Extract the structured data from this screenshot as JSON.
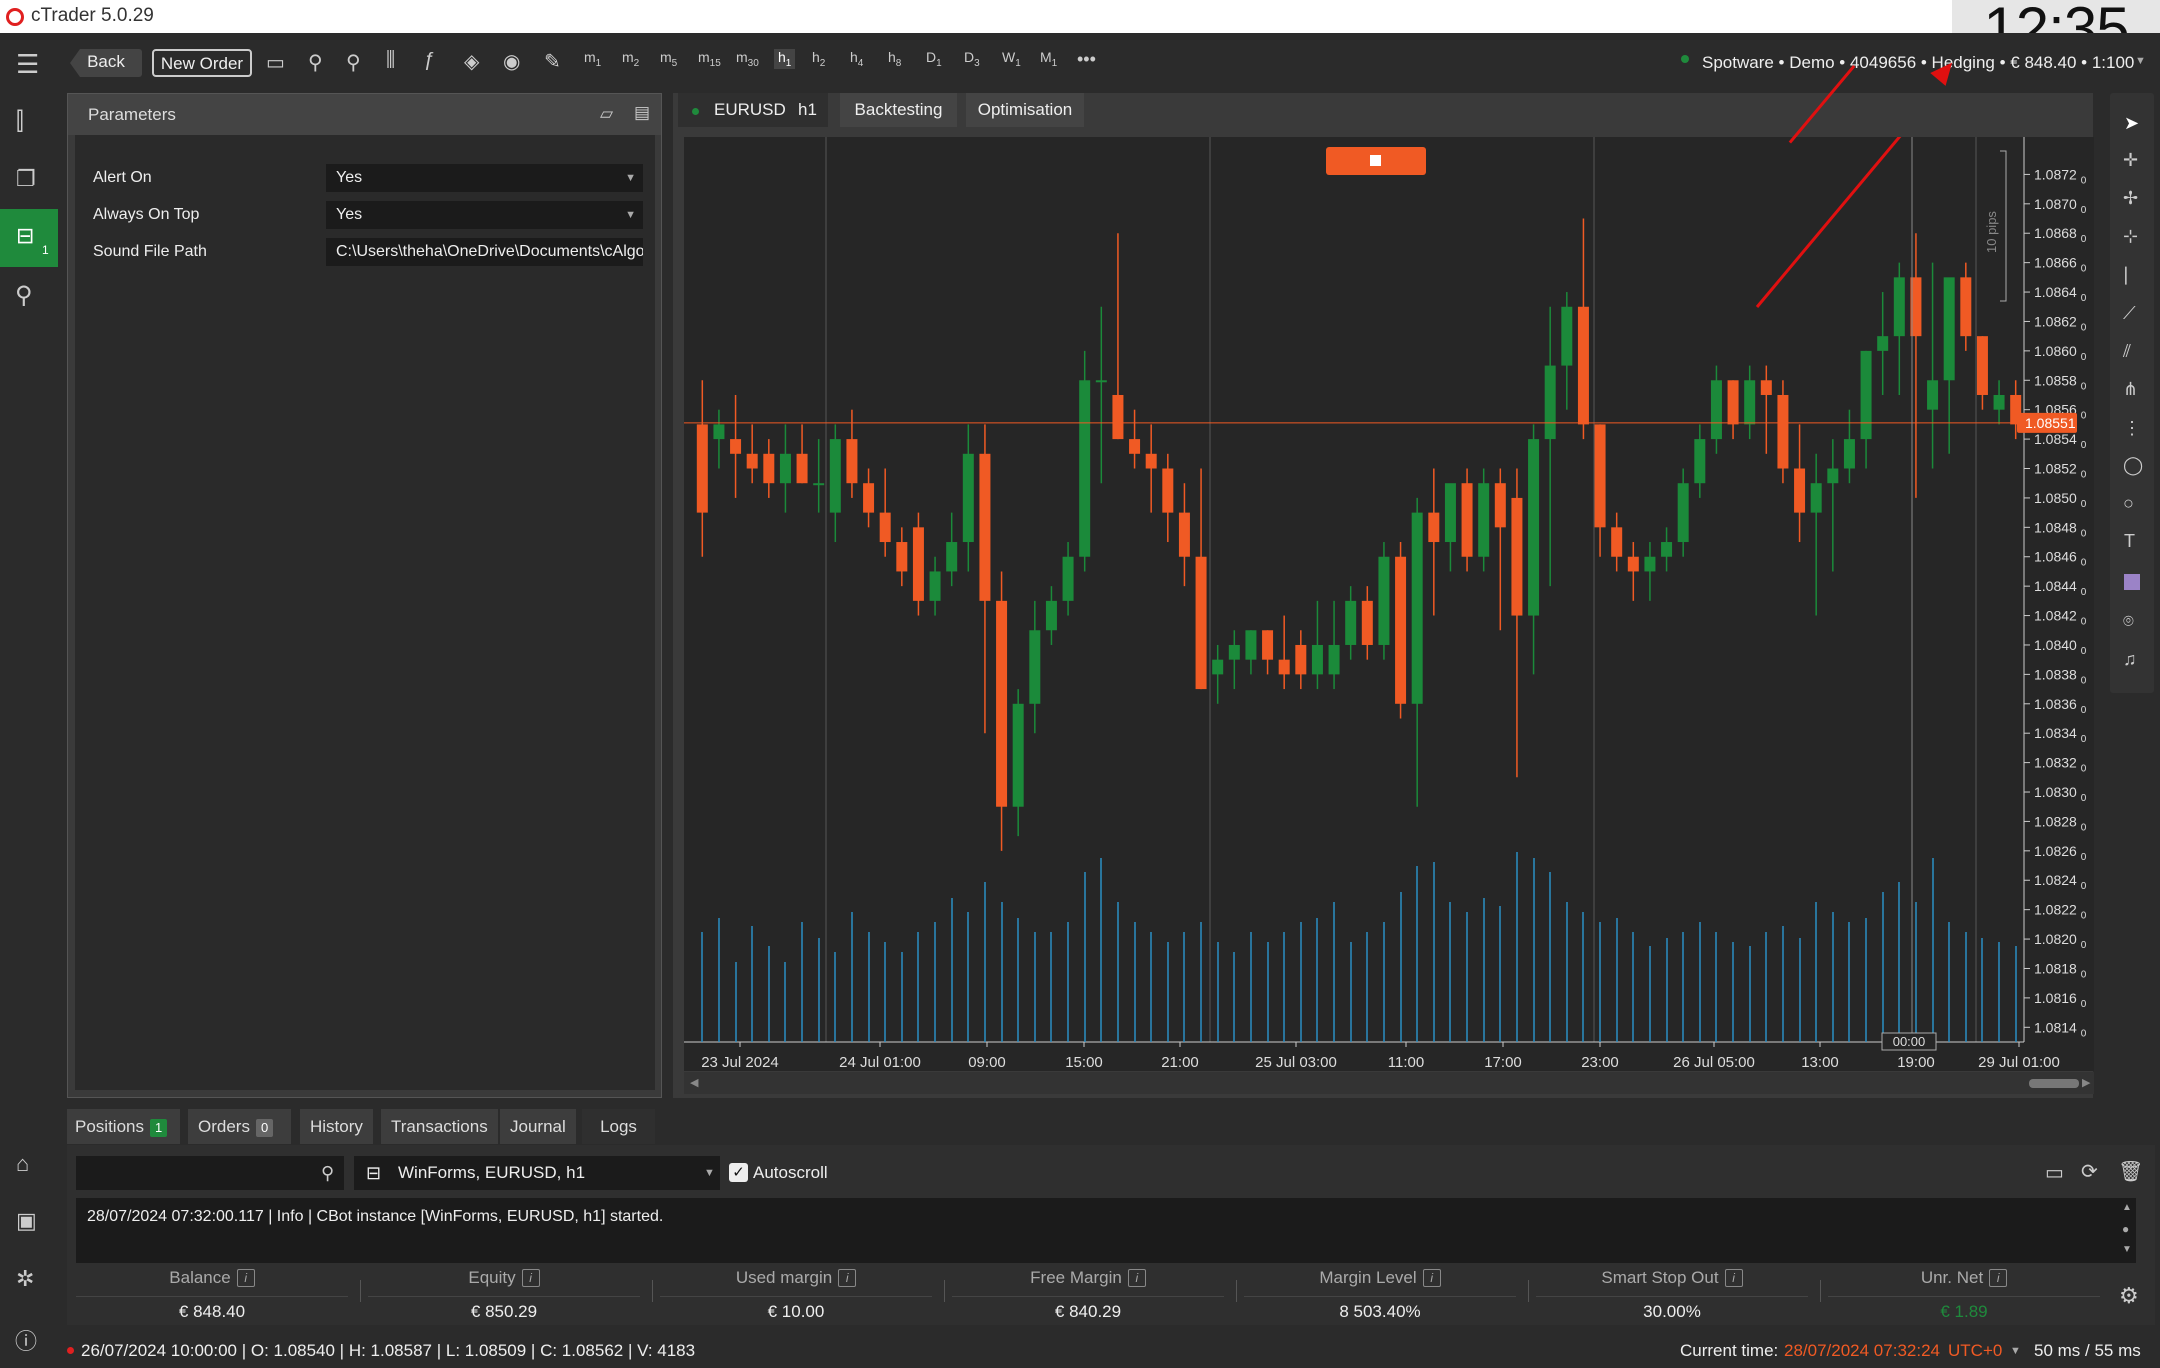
{
  "app": {
    "title": "cTrader 5.0.29",
    "clock": "12:35"
  },
  "toolbar": {
    "back": "Back",
    "new_order": "New Order",
    "timeframes": [
      {
        "l": "m",
        "s": "1"
      },
      {
        "l": "m",
        "s": "2"
      },
      {
        "l": "m",
        "s": "5"
      },
      {
        "l": "m",
        "s": "15"
      },
      {
        "l": "m",
        "s": "30"
      },
      {
        "l": "h",
        "s": "1"
      },
      {
        "l": "h",
        "s": "2"
      },
      {
        "l": "h",
        "s": "4"
      },
      {
        "l": "h",
        "s": "8"
      },
      {
        "l": "D",
        "s": "1"
      },
      {
        "l": "D",
        "s": "3"
      },
      {
        "l": "W",
        "s": "1"
      },
      {
        "l": "M",
        "s": "1"
      }
    ],
    "more": "•••",
    "account": "Spotware • Demo • 4049656 • Hedging • € 848.40 • 1:100"
  },
  "params": {
    "title": "Parameters",
    "rows": [
      {
        "label": "Alert On",
        "value": "Yes"
      },
      {
        "label": "Always On Top",
        "value": "Yes"
      },
      {
        "label": "Sound File Path",
        "value": "C:\\Users\\theha\\OneDrive\\Documents\\cAlgo"
      }
    ]
  },
  "chart_tabs": {
    "symbol": "EURUSD",
    "tf": "h1",
    "backtesting": "Backtesting",
    "optimisation": "Optimisation"
  },
  "chart_data": {
    "type": "candlestick",
    "price_label": "1.08551",
    "range_label": "10 pips",
    "cursor_time": "00:00",
    "y_ticks": [
      "1.08720",
      "1.08700",
      "1.08680",
      "1.08660",
      "1.08640",
      "1.08620",
      "1.08600",
      "1.08580",
      "1.08560",
      "1.08540",
      "1.08520",
      "1.08500",
      "1.08480",
      "1.08460",
      "1.08440",
      "1.08420",
      "1.08400",
      "1.08380",
      "1.08360",
      "1.08340",
      "1.08320",
      "1.08300",
      "1.08280",
      "1.08260",
      "1.08240",
      "1.08220",
      "1.08200",
      "1.08180",
      "1.08160",
      "1.08140"
    ],
    "ylim": [
      1.0813,
      1.0874
    ],
    "x_ticks": [
      "23 Jul 2024",
      "24 Jul 01:00",
      "09:00",
      "15:00",
      "21:00",
      "25 Jul 03:00",
      "11:00",
      "17:00",
      "23:00",
      "26 Jul 05:00",
      "13:00",
      "19:00",
      "29 Jul 01:00"
    ],
    "current_price": 1.08551,
    "ohlc": [
      [
        1.0855,
        1.0858,
        1.0846,
        1.0849
      ],
      [
        1.0854,
        1.0856,
        1.0852,
        1.0855
      ],
      [
        1.0854,
        1.0857,
        1.085,
        1.0853
      ],
      [
        1.0853,
        1.0855,
        1.0851,
        1.0852
      ],
      [
        1.0853,
        1.0854,
        1.085,
        1.0851
      ],
      [
        1.0851,
        1.0855,
        1.0849,
        1.0853
      ],
      [
        1.0853,
        1.0855,
        1.0851,
        1.0851
      ],
      [
        1.0851,
        1.0854,
        1.0849,
        1.0851
      ],
      [
        1.0849,
        1.0855,
        1.0847,
        1.0854
      ],
      [
        1.0854,
        1.0856,
        1.085,
        1.0851
      ],
      [
        1.0851,
        1.0852,
        1.0848,
        1.0849
      ],
      [
        1.0849,
        1.0852,
        1.0846,
        1.0847
      ],
      [
        1.0847,
        1.0848,
        1.0844,
        1.0845
      ],
      [
        1.0848,
        1.0849,
        1.0842,
        1.0843
      ],
      [
        1.0843,
        1.0846,
        1.0842,
        1.0845
      ],
      [
        1.0845,
        1.0849,
        1.0844,
        1.0847
      ],
      [
        1.0847,
        1.0855,
        1.0845,
        1.0853
      ],
      [
        1.0853,
        1.0855,
        1.0834,
        1.0843
      ],
      [
        1.0843,
        1.0845,
        1.0826,
        1.0829
      ],
      [
        1.0829,
        1.0837,
        1.0827,
        1.0836
      ],
      [
        1.0836,
        1.0843,
        1.0834,
        1.0841
      ],
      [
        1.0841,
        1.0844,
        1.084,
        1.0843
      ],
      [
        1.0843,
        1.0847,
        1.0842,
        1.0846
      ],
      [
        1.0846,
        1.086,
        1.0845,
        1.0858
      ],
      [
        1.0858,
        1.0863,
        1.0851,
        1.0858
      ],
      [
        1.0857,
        1.0868,
        1.0854,
        1.0854
      ],
      [
        1.0854,
        1.0856,
        1.0852,
        1.0853
      ],
      [
        1.0853,
        1.0855,
        1.0849,
        1.0852
      ],
      [
        1.0852,
        1.0853,
        1.0847,
        1.0849
      ],
      [
        1.0849,
        1.0851,
        1.0844,
        1.0846
      ],
      [
        1.0846,
        1.0852,
        1.0837,
        1.0837
      ],
      [
        1.0838,
        1.084,
        1.0836,
        1.0839
      ],
      [
        1.0839,
        1.0841,
        1.0837,
        1.084
      ],
      [
        1.0839,
        1.0841,
        1.0838,
        1.0841
      ],
      [
        1.0841,
        1.0841,
        1.0838,
        1.0839
      ],
      [
        1.0839,
        1.0842,
        1.0837,
        1.0838
      ],
      [
        1.084,
        1.0841,
        1.0837,
        1.0838
      ],
      [
        1.0838,
        1.0843,
        1.0837,
        1.084
      ],
      [
        1.0838,
        1.0843,
        1.0837,
        1.084
      ],
      [
        1.084,
        1.0844,
        1.0839,
        1.0843
      ],
      [
        1.0843,
        1.0844,
        1.0839,
        1.084
      ],
      [
        1.084,
        1.0847,
        1.0839,
        1.0846
      ],
      [
        1.0846,
        1.0847,
        1.0835,
        1.0836
      ],
      [
        1.0836,
        1.085,
        1.0829,
        1.0849
      ],
      [
        1.0849,
        1.0852,
        1.0842,
        1.0847
      ],
      [
        1.0847,
        1.085,
        1.0845,
        1.0851
      ],
      [
        1.0851,
        1.0852,
        1.0845,
        1.0846
      ],
      [
        1.0846,
        1.0852,
        1.0845,
        1.0851
      ],
      [
        1.0851,
        1.0852,
        1.0841,
        1.0848
      ],
      [
        1.085,
        1.0852,
        1.0831,
        1.0842
      ],
      [
        1.0842,
        1.0855,
        1.0838,
        1.0854
      ],
      [
        1.0854,
        1.0863,
        1.0844,
        1.0859
      ],
      [
        1.0859,
        1.0864,
        1.0856,
        1.0863
      ],
      [
        1.0863,
        1.0869,
        1.0854,
        1.0855
      ],
      [
        1.0855,
        1.0855,
        1.0846,
        1.0848
      ],
      [
        1.0848,
        1.0849,
        1.0845,
        1.0846
      ],
      [
        1.0846,
        1.0847,
        1.0843,
        1.0845
      ],
      [
        1.0845,
        1.0847,
        1.0843,
        1.0846
      ],
      [
        1.0846,
        1.0848,
        1.0845,
        1.0847
      ],
      [
        1.0847,
        1.0852,
        1.0846,
        1.0851
      ],
      [
        1.0851,
        1.0855,
        1.085,
        1.0854
      ],
      [
        1.0854,
        1.0859,
        1.0853,
        1.0858
      ],
      [
        1.0858,
        1.0858,
        1.0854,
        1.0855
      ],
      [
        1.0855,
        1.0859,
        1.0854,
        1.0858
      ],
      [
        1.0858,
        1.0859,
        1.0853,
        1.0857
      ],
      [
        1.0857,
        1.0858,
        1.0851,
        1.0852
      ],
      [
        1.0852,
        1.0855,
        1.0847,
        1.0849
      ],
      [
        1.0849,
        1.0853,
        1.0842,
        1.0851
      ],
      [
        1.0851,
        1.0854,
        1.0845,
        1.0852
      ],
      [
        1.0852,
        1.0856,
        1.0851,
        1.0854
      ],
      [
        1.0854,
        1.086,
        1.0852,
        1.086
      ],
      [
        1.086,
        1.0864,
        1.0857,
        1.0861
      ],
      [
        1.0861,
        1.0866,
        1.0857,
        1.0865
      ],
      [
        1.0865,
        1.0868,
        1.085,
        1.0861
      ],
      [
        1.0856,
        1.0866,
        1.0852,
        1.0858
      ],
      [
        1.0858,
        1.0862,
        1.0853,
        1.0865
      ],
      [
        1.0865,
        1.0866,
        1.086,
        1.0861
      ],
      [
        1.0861,
        1.0861,
        1.0856,
        1.0857
      ],
      [
        1.0856,
        1.0858,
        1.0855,
        1.0857
      ],
      [
        1.0857,
        1.0858,
        1.0854,
        1.0855
      ]
    ],
    "volume": [
      55,
      62,
      40,
      58,
      48,
      40,
      60,
      52,
      45,
      65,
      55,
      50,
      45,
      55,
      60,
      72,
      65,
      80,
      70,
      62,
      55,
      55,
      60,
      85,
      92,
      70,
      60,
      55,
      50,
      55,
      60,
      50,
      45,
      55,
      50,
      55,
      60,
      62,
      70,
      50,
      55,
      60,
      75,
      88,
      90,
      70,
      65,
      72,
      68,
      95,
      92,
      85,
      70,
      65,
      60,
      62,
      55,
      48,
      52,
      55,
      60,
      55,
      50,
      48,
      55,
      58,
      52,
      70,
      65,
      60,
      62,
      75,
      80,
      70,
      92,
      60,
      55,
      52,
      50,
      48
    ]
  },
  "bottom_tabs": {
    "positions": "Positions",
    "positions_count": "1",
    "orders": "Orders",
    "orders_count": "0",
    "history": "History",
    "transactions": "Transactions",
    "journal": "Journal",
    "logs": "Logs"
  },
  "log": {
    "instance": "WinForms, EURUSD, h1",
    "autoscroll": "Autoscroll",
    "message": "28/07/2024 07:32:00.117 | Info | CBot instance [WinForms, EURUSD, h1] started."
  },
  "stats": [
    {
      "label": "Balance",
      "value": "€ 848.40"
    },
    {
      "label": "Equity",
      "value": "€ 850.29"
    },
    {
      "label": "Used margin",
      "value": "€ 10.00"
    },
    {
      "label": "Free Margin",
      "value": "€ 840.29"
    },
    {
      "label": "Margin Level",
      "value": "8 503.40%"
    },
    {
      "label": "Smart Stop Out",
      "value": "30.00%"
    },
    {
      "label": "Unr. Net",
      "value": "€ 1.89"
    }
  ],
  "status": {
    "bar": "26/07/2024 10:00:00 |  O: 1.08540 |  H: 1.08587 |  L: 1.08509 |  C: 1.08562 |  V: 4183",
    "current_label": "Current time:",
    "current_value": "28/07/2024 07:32:24",
    "tz": "UTC+0",
    "latency": "50 ms / 55 ms"
  },
  "colors": {
    "bull": "#1b8a3a",
    "bear": "#f05a24",
    "accent": "#f05a24",
    "volume": "#2a8fc4"
  }
}
